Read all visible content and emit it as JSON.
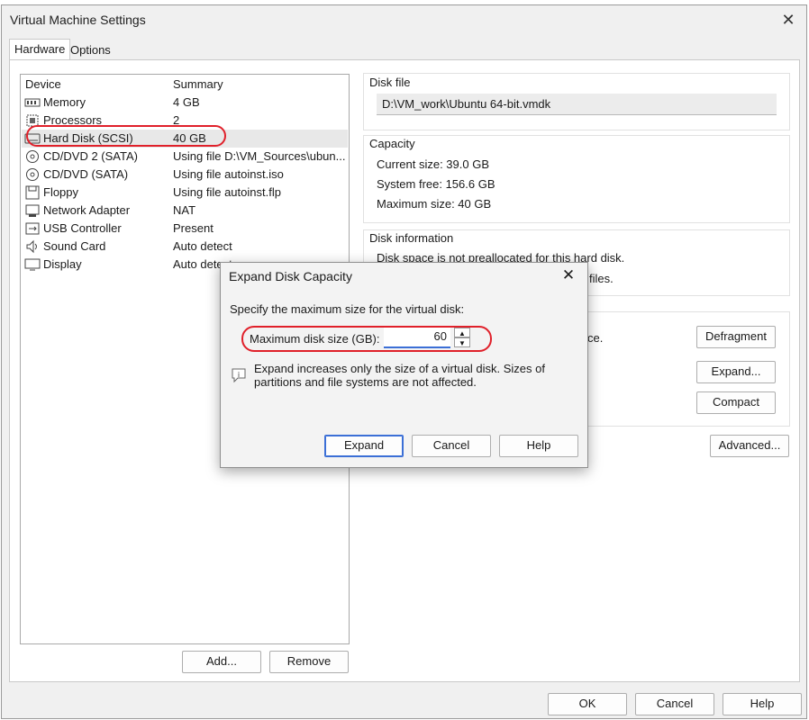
{
  "window": {
    "title": "Virtual Machine Settings"
  },
  "tabs": [
    {
      "label": "Hardware"
    },
    {
      "label": "Options"
    }
  ],
  "devices": {
    "col_device": "Device",
    "col_summary": "Summary",
    "items": [
      {
        "name": "Memory",
        "summary": "4 GB"
      },
      {
        "name": "Processors",
        "summary": "2"
      },
      {
        "name": "Hard Disk (SCSI)",
        "summary": "40 GB"
      },
      {
        "name": "CD/DVD 2 (SATA)",
        "summary": "Using file D:\\VM_Sources\\ubun..."
      },
      {
        "name": "CD/DVD (SATA)",
        "summary": "Using file autoinst.iso"
      },
      {
        "name": "Floppy",
        "summary": "Using file autoinst.flp"
      },
      {
        "name": "Network Adapter",
        "summary": "NAT"
      },
      {
        "name": "USB Controller",
        "summary": "Present"
      },
      {
        "name": "Sound Card",
        "summary": "Auto detect"
      },
      {
        "name": "Display",
        "summary": "Auto detect"
      }
    ],
    "add_label": "Add...",
    "remove_label": "Remove"
  },
  "disk_file": {
    "label": "Disk file",
    "path": "D:\\VM_work\\Ubuntu 64-bit.vmdk"
  },
  "capacity": {
    "label": "Capacity",
    "current": "Current size: 39.0 GB",
    "free": "System free: 156.6 GB",
    "maximum": "Maximum size: 40 GB"
  },
  "disk_info": {
    "label": "Disk information",
    "line1": "Disk space is not preallocated for this hard disk.",
    "line2_tail": "files."
  },
  "utilities": {
    "text_tail": "ce.",
    "defragment_label": "Defragment",
    "expand_label": "Expand...",
    "compact_label": "Compact"
  },
  "advanced_label": "Advanced...",
  "footer": {
    "ok_label": "OK",
    "cancel_label": "Cancel",
    "help_label": "Help"
  },
  "dialog": {
    "title": "Expand Disk Capacity",
    "instruction": "Specify the maximum size for the virtual disk:",
    "size_label": "Maximum disk size (GB):",
    "size_value": "60",
    "info_line1": "Expand increases only the size of a virtual disk. Sizes of",
    "info_line2": "partitions and file systems are not affected.",
    "expand_label": "Expand",
    "cancel_label": "Cancel",
    "help_label": "Help"
  },
  "colors": {
    "highlight_ring": "#e0202a",
    "focus_underline": "#3b6fd6"
  }
}
